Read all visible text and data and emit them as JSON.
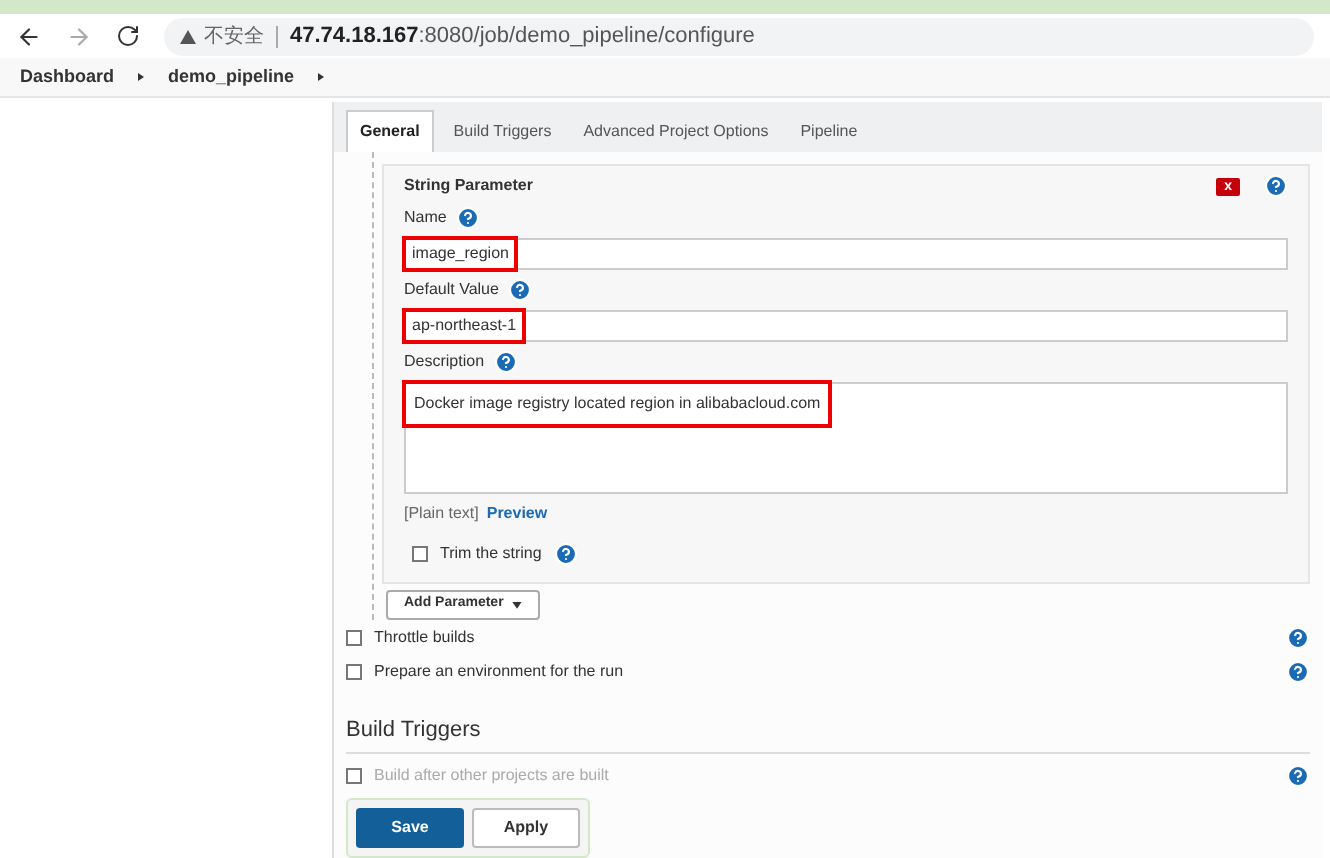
{
  "browser": {
    "security_label": "不安全",
    "url_host": "47.74.18.167",
    "url_rest": ":8080/job/demo_pipeline/configure"
  },
  "breadcrumbs": [
    "Dashboard",
    "demo_pipeline"
  ],
  "tabs": [
    {
      "label": "General",
      "selected": true
    },
    {
      "label": "Build Triggers",
      "selected": false
    },
    {
      "label": "Advanced Project Options",
      "selected": false
    },
    {
      "label": "Pipeline",
      "selected": false
    }
  ],
  "parameter": {
    "title": "String Parameter",
    "delete_label": "x",
    "fields": [
      {
        "label": "Name",
        "value": "image_region",
        "highlighted": true,
        "kind": "input"
      },
      {
        "label": "Default Value",
        "value": "ap-northeast-1",
        "highlighted": true,
        "kind": "input"
      },
      {
        "label": "Description",
        "value": "Docker image registry located region in alibabacloud.com",
        "highlighted": true,
        "kind": "textarea"
      }
    ],
    "format_note": "[Plain text]",
    "preview_link": "Preview",
    "trim": {
      "label": "Trim the string",
      "checked": false
    }
  },
  "add_parameter": "Add Parameter",
  "options": [
    {
      "label": "Throttle builds",
      "checked": false
    },
    {
      "label": "Prepare an environment for the run",
      "checked": false
    }
  ],
  "section_title": "Build Triggers",
  "triggers": [
    {
      "label": "Build after other projects are built",
      "checked": false
    }
  ],
  "buttons": {
    "save": "Save",
    "apply": "Apply"
  }
}
